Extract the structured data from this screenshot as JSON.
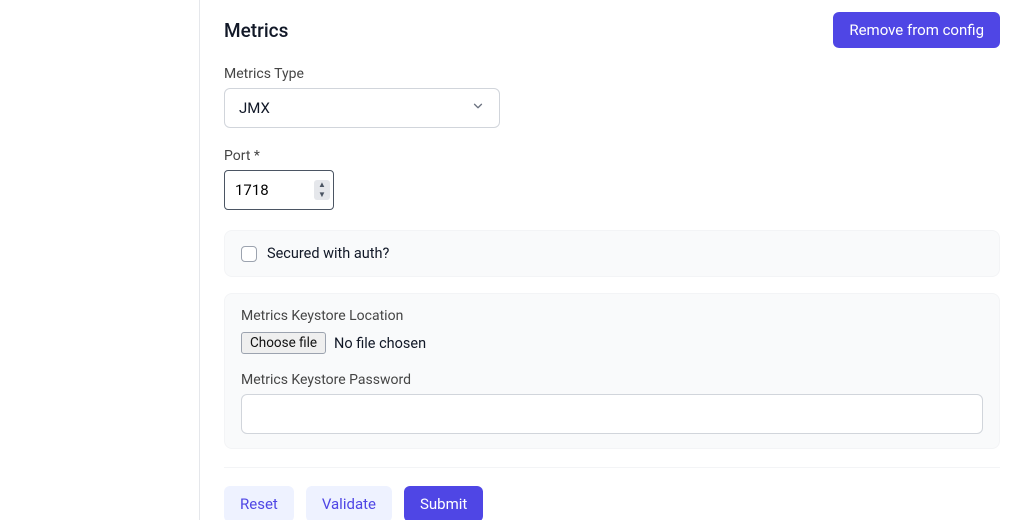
{
  "section": {
    "title": "Metrics",
    "remove_btn": "Remove from config"
  },
  "metrics_type": {
    "label": "Metrics Type",
    "value": "JMX"
  },
  "port": {
    "label": "Port *",
    "value": "1718"
  },
  "auth": {
    "label": "Secured with auth?",
    "checked": false
  },
  "keystore": {
    "location_label": "Metrics Keystore Location",
    "choose_btn": "Choose file",
    "status": "No file chosen",
    "password_label": "Metrics Keystore Password",
    "password_value": ""
  },
  "actions": {
    "reset": "Reset",
    "validate": "Validate",
    "submit": "Submit"
  }
}
